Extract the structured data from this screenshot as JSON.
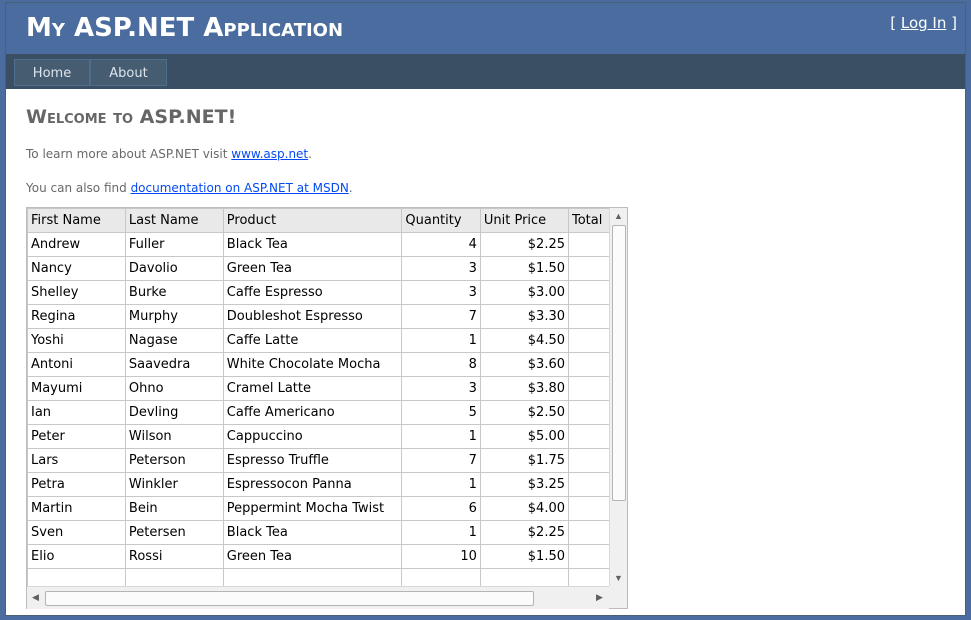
{
  "header": {
    "app_title": "My ASP.NET Application",
    "login_prefix": "[ ",
    "login_link": "Log In",
    "login_suffix": " ]"
  },
  "menu": {
    "items": [
      {
        "label": "Home"
      },
      {
        "label": "About"
      }
    ]
  },
  "main": {
    "heading": "Welcome to ASP.NET!",
    "para1_text": "To learn more about ASP.NET visit ",
    "para1_link": "www.asp.net",
    "para1_end": ".",
    "para2_text": "You can also find ",
    "para2_link": "documentation on ASP.NET at MSDN",
    "para2_end": "."
  },
  "grid": {
    "columns": [
      "First Name",
      "Last Name",
      "Product",
      "Quantity",
      "Unit Price",
      "Total"
    ],
    "rows": [
      [
        "Andrew",
        "Fuller",
        "Black Tea",
        "4",
        "$2.25"
      ],
      [
        "Nancy",
        "Davolio",
        "Green Tea",
        "3",
        "$1.50"
      ],
      [
        "Shelley",
        "Burke",
        "Caffe Espresso",
        "3",
        "$3.00"
      ],
      [
        "Regina",
        "Murphy",
        "Doubleshot Espresso",
        "7",
        "$3.30"
      ],
      [
        "Yoshi",
        "Nagase",
        "Caffe Latte",
        "1",
        "$4.50"
      ],
      [
        "Antoni",
        "Saavedra",
        "White Chocolate Mocha",
        "8",
        "$3.60"
      ],
      [
        "Mayumi",
        "Ohno",
        "Cramel Latte",
        "3",
        "$3.80"
      ],
      [
        "Ian",
        "Devling",
        "Caffe Americano",
        "5",
        "$2.50"
      ],
      [
        "Peter",
        "Wilson",
        "Cappuccino",
        "1",
        "$5.00"
      ],
      [
        "Lars",
        "Peterson",
        "Espresso Truffle",
        "7",
        "$1.75"
      ],
      [
        "Petra",
        "Winkler",
        "Espressocon Panna",
        "1",
        "$3.25"
      ],
      [
        "Martin",
        "Bein",
        "Peppermint Mocha Twist",
        "6",
        "$4.00"
      ],
      [
        "Sven",
        "Petersen",
        "Black Tea",
        "1",
        "$2.25"
      ],
      [
        "Elio",
        "Rossi",
        "Green Tea",
        "10",
        "$1.50"
      ],
      [
        "",
        "",
        "",
        "",
        ""
      ]
    ]
  },
  "icons": {
    "scroll_up": "scroll-up-arrow-icon",
    "scroll_down": "scroll-down-arrow-icon",
    "scroll_left": "scroll-left-arrow-icon",
    "scroll_right": "scroll-right-arrow-icon"
  }
}
